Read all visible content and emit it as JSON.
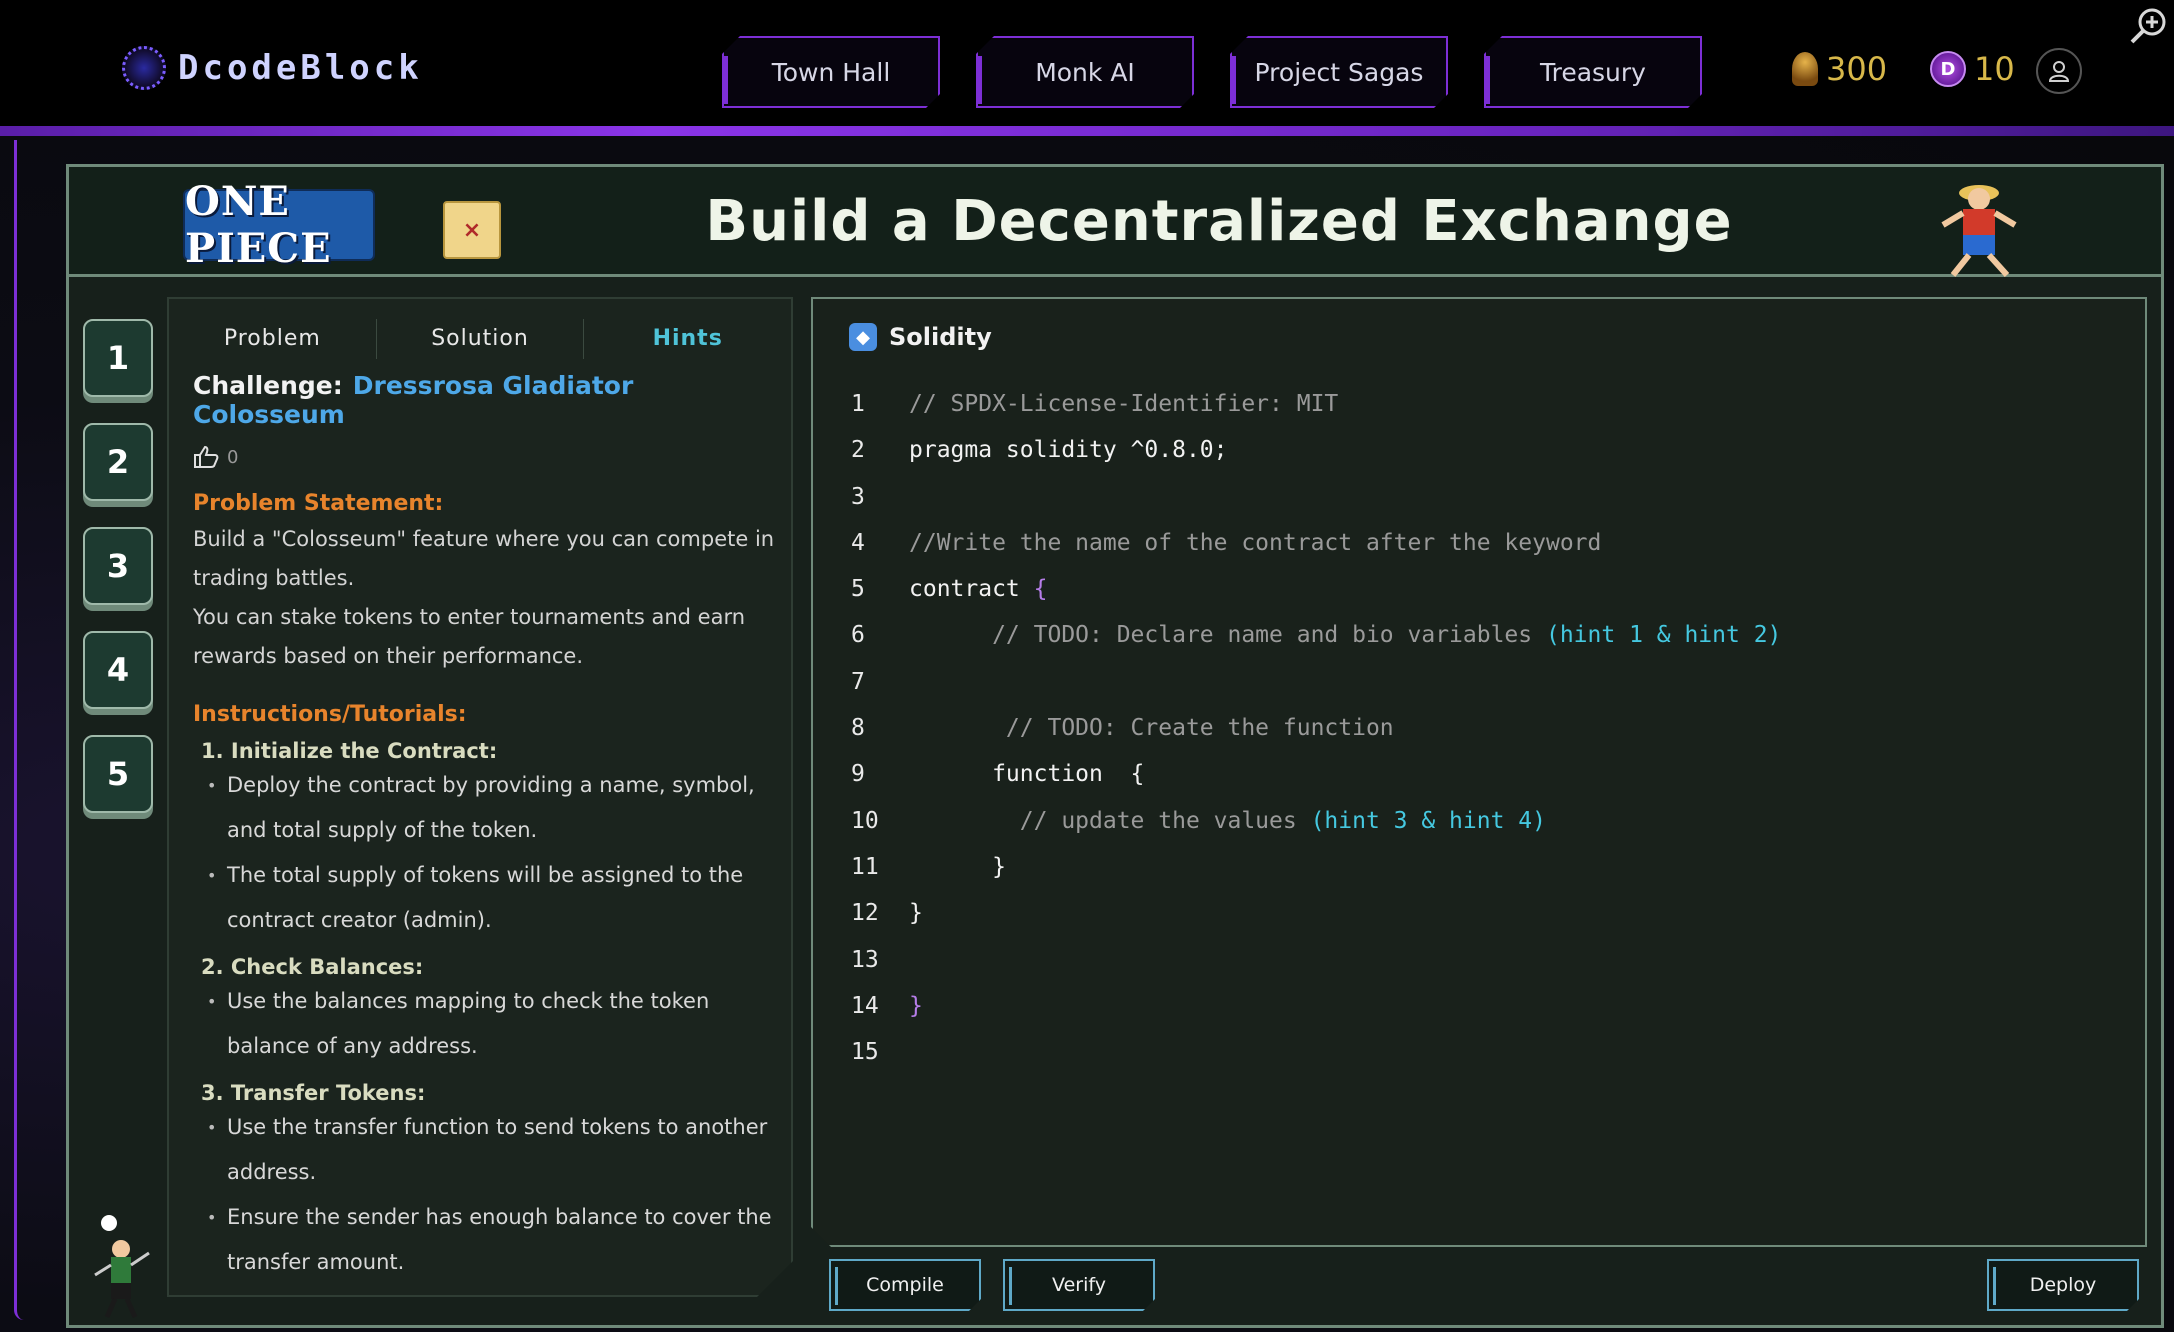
{
  "brand": {
    "name": "DcodeBlock"
  },
  "nav": {
    "items": [
      {
        "label": "Town Hall"
      },
      {
        "label": "Monk AI"
      },
      {
        "label": "Project Sagas"
      },
      {
        "label": "Treasury"
      }
    ]
  },
  "stats": {
    "trophies": "300",
    "coins": "10",
    "coin_glyph": "D"
  },
  "header": {
    "logo_text": "ONE PIECE",
    "map_glyph": "×",
    "title": "Build a Decentralized Exchange"
  },
  "steps": [
    "1",
    "2",
    "3",
    "4",
    "5"
  ],
  "problem_panel": {
    "tabs": [
      {
        "label": "Problem"
      },
      {
        "label": "Solution"
      },
      {
        "label": "Hints"
      }
    ],
    "challenge_label": "Challenge:",
    "challenge_name": "Dressrosa Gladiator Colosseum",
    "likes": "0",
    "problem_statement_heading": "Problem Statement:",
    "problem_statement_1": "Build a \"Colosseum\" feature where you can compete in trading battles.",
    "problem_statement_2": "You can stake tokens to enter tournaments and earn rewards based on their performance.",
    "instructions_heading": "Instructions/Tutorials:",
    "sections": [
      {
        "heading": "1. Initialize the Contract:",
        "bullets": [
          "Deploy the contract by providing a name, symbol, and total supply of the token.",
          "The total supply of tokens will be assigned to the contract creator (admin)."
        ]
      },
      {
        "heading": "2. Check Balances:",
        "bullets": [
          "Use the balances mapping to check the token balance of any address."
        ]
      },
      {
        "heading": "3.  Transfer Tokens:",
        "bullets": [
          "Use the transfer function to send tokens to another address.",
          "Ensure the sender has enough balance to cover the transfer amount."
        ]
      }
    ]
  },
  "editor": {
    "language": "Solidity",
    "lines": [
      {
        "n": "1",
        "parts": [
          {
            "t": "// SPDX-License-Identifier: MIT",
            "c": "comment"
          }
        ]
      },
      {
        "n": "2",
        "parts": [
          {
            "t": "pragma solidity ^0.8.0;",
            "c": "plain"
          }
        ]
      },
      {
        "n": "3",
        "parts": []
      },
      {
        "n": "4",
        "parts": [
          {
            "t": "//Write the name of the contract after the keyword",
            "c": "comment"
          }
        ]
      },
      {
        "n": "5",
        "parts": [
          {
            "t": "contract ",
            "c": "plain"
          },
          {
            "t": "{",
            "c": "brace"
          }
        ]
      },
      {
        "n": "6",
        "parts": [
          {
            "t": "      // TODO: Declare name and bio variables ",
            "c": "comment"
          },
          {
            "t": "(hint 1 & hint 2)",
            "c": "hint"
          }
        ]
      },
      {
        "n": "7",
        "parts": []
      },
      {
        "n": "8",
        "parts": [
          {
            "t": "       // TODO: Create the function",
            "c": "comment"
          }
        ]
      },
      {
        "n": "9",
        "parts": [
          {
            "t": "      function  {",
            "c": "plain"
          }
        ]
      },
      {
        "n": "10",
        "parts": [
          {
            "t": "        // update the values ",
            "c": "comment"
          },
          {
            "t": "(hint 3 & hint 4)",
            "c": "hint"
          }
        ]
      },
      {
        "n": "11",
        "parts": [
          {
            "t": "      }",
            "c": "plain"
          }
        ]
      },
      {
        "n": "12",
        "parts": [
          {
            "t": "}",
            "c": "plain"
          }
        ]
      },
      {
        "n": "13",
        "parts": []
      },
      {
        "n": "14",
        "parts": [
          {
            "t": "}",
            "c": "brace"
          }
        ]
      },
      {
        "n": "15",
        "parts": []
      }
    ]
  },
  "actions": {
    "compile": "Compile",
    "verify": "Verify",
    "deploy": "Deploy"
  },
  "colors": {
    "accent_purple": "#7d2fd6",
    "hint_cyan": "#45c8e0",
    "heading_orange": "#e8842c"
  }
}
